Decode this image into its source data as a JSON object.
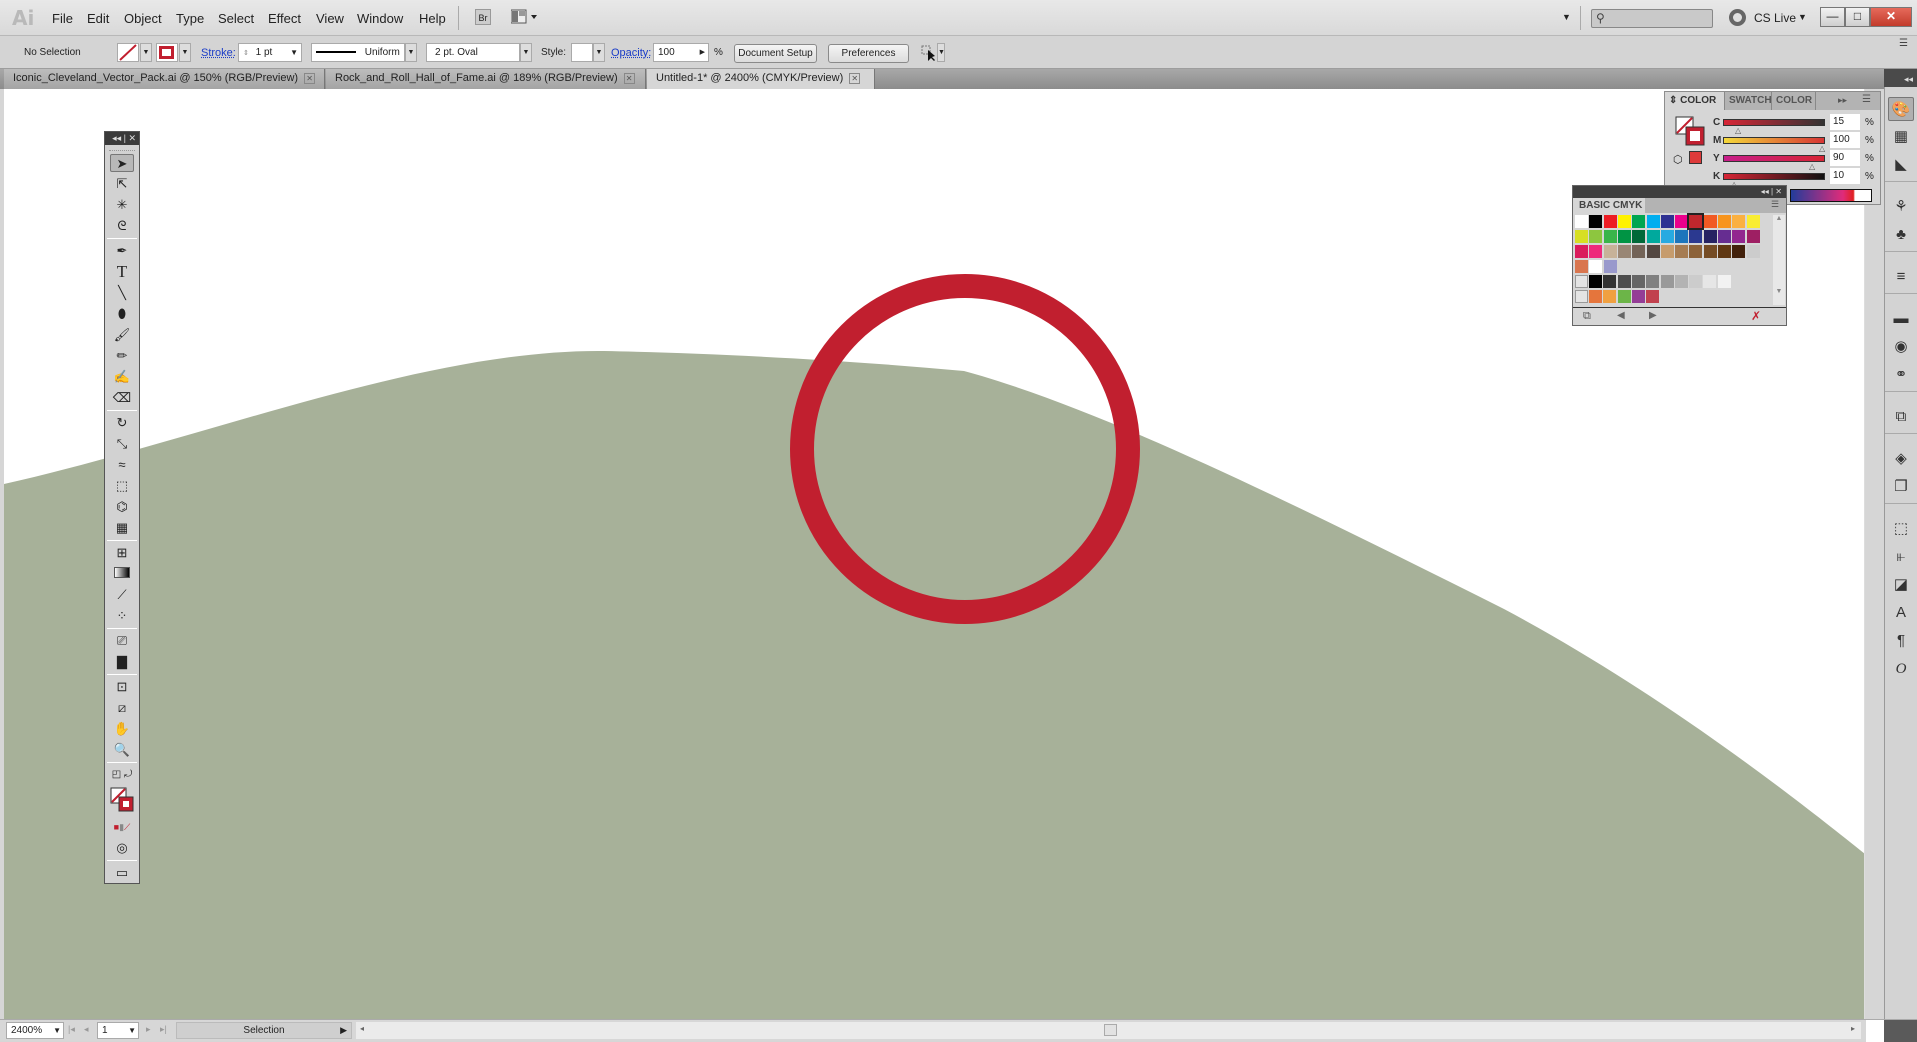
{
  "app": {
    "logo": "Ai"
  },
  "menu": [
    "File",
    "Edit",
    "Object",
    "Type",
    "Select",
    "Effect",
    "View",
    "Window",
    "Help"
  ],
  "menubar_extras": {
    "bridge_label": "Br",
    "cs_live_label": "CS Live",
    "search_placeholder": ""
  },
  "window_controls": {
    "minimize": "—",
    "restore": "□",
    "close": "✕"
  },
  "control_bar": {
    "selection_status": "No Selection",
    "stroke_label": "Stroke:",
    "stroke_weight": "1 pt",
    "profile": "Uniform",
    "brush": "2 pt. Oval",
    "style_label": "Style:",
    "opacity_label": "Opacity:",
    "opacity_value": "100",
    "opacity_unit": "%",
    "document_setup": "Document Setup",
    "preferences": "Preferences"
  },
  "tabs": [
    {
      "label": "Iconic_Cleveland_Vector_Pack.ai @ 150% (RGB/Preview)",
      "active": false
    },
    {
      "label": "Rock_and_Roll_Hall_of_Fame.ai @ 189% (RGB/Preview)",
      "active": false
    },
    {
      "label": "Untitled-1* @ 2400% (CMYK/Preview)",
      "active": true
    }
  ],
  "artwork": {
    "ring_color": "#c11f2f",
    "hill_color": "#a7b199",
    "canvas_color": "#ffffff"
  },
  "tools": [
    "selection",
    "direct-selection",
    "magic-wand",
    "lasso",
    "pen",
    "type",
    "line-segment",
    "ellipse",
    "paintbrush",
    "pencil",
    "blob-brush",
    "eraser",
    "rotate",
    "scale",
    "warp",
    "free-transform",
    "shape-builder",
    "perspective-grid",
    "mesh",
    "gradient",
    "eyedropper",
    "blend",
    "symbol-sprayer",
    "column-graph",
    "artboard",
    "slice",
    "hand",
    "zoom"
  ],
  "color_panel": {
    "tabs": [
      "COLOR",
      "SWATCH",
      "COLOR G"
    ],
    "channels": [
      {
        "label": "C",
        "value": "15",
        "unit": "%"
      },
      {
        "label": "M",
        "value": "100",
        "unit": "%"
      },
      {
        "label": "Y",
        "value": "90",
        "unit": "%"
      },
      {
        "label": "K",
        "value": "10",
        "unit": "%"
      }
    ],
    "fill": "none",
    "stroke_color": "#c11f2f"
  },
  "swatch_panel": {
    "title": "BASIC CMYK",
    "rows": [
      [
        "#ffffff",
        "#000000",
        "#ed1c24",
        "#fff200",
        "#00a651",
        "#00aeef",
        "#2e3192",
        "#ec008c",
        "#c1272d",
        "#f15a24",
        "#f7941d",
        "#fbb040",
        "#f9ed32"
      ],
      [
        "#d7df23",
        "#8dc63f",
        "#39b54a",
        "#009444",
        "#006838",
        "#00a99d",
        "#27aae1",
        "#1c75bc",
        "#2b3990",
        "#262262",
        "#662d91",
        "#92278f",
        "#9e1f63"
      ],
      [
        "#da1c5c",
        "#ee2a7b",
        "#c7b299",
        "#998675",
        "#736357",
        "#534741",
        "#c69c6d",
        "#a67c52",
        "#8c6239",
        "#754c24",
        "#603813",
        "#42210b",
        "#cccccc"
      ],
      [
        "#d9764f",
        "#ffffff",
        "#9999cc"
      ],
      [
        "#000000",
        "#333333",
        "#4d4d4d",
        "#666666",
        "#808080",
        "#999999",
        "#b3b3b3",
        "#cccccc",
        "#e6e6e6",
        "#f2f2f2"
      ],
      [
        "#e5753c",
        "#f0a040",
        "#6cb548",
        "#943d96",
        "#c1414e"
      ]
    ]
  },
  "status_bar": {
    "zoom": "2400%",
    "artboard": "1",
    "tool_status": "Selection"
  }
}
